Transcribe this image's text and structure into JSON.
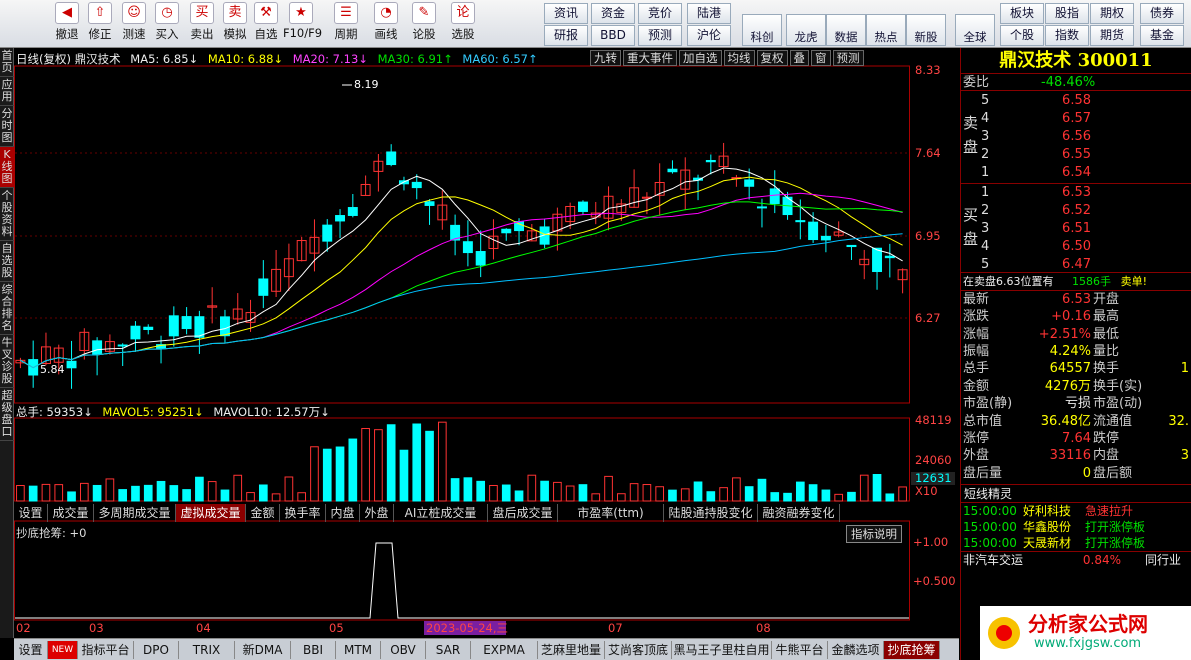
{
  "toolbar": {
    "buttons": [
      "撤退",
      "修正",
      "测速",
      "买入",
      "卖出",
      "模拟",
      "自选",
      "F10/F9",
      "周期",
      "画线",
      "论股",
      "选股"
    ],
    "small_buttons": [
      "资讯",
      "资金",
      "竞价",
      "陆港",
      "研报",
      "BBD",
      "预测",
      "沪伦",
      "科创",
      "龙虎",
      "数据",
      "热点",
      "新股",
      "全球",
      "板块",
      "股指",
      "期权",
      "债券",
      "个股",
      "指数",
      "期货",
      "基金"
    ]
  },
  "leftnav": [
    "首页",
    "应用",
    "分时图",
    "K线图",
    "个股资料",
    "自选股",
    "综合排名",
    "牛叉诊股",
    "超级盘口"
  ],
  "kline_header": {
    "title": "日线(复权)  鼎汉技术",
    "ma5": "MA5: 6.85↓",
    "ma10": "MA10: 6.88↓",
    "ma20": "MA20: 7.13↓",
    "ma30": "MA30: 6.91↑",
    "ma60": "MA60: 6.57↑",
    "tools": [
      "九转",
      "重大事件",
      "加自选",
      "均线",
      "复权",
      "叠",
      "窗",
      "预测"
    ]
  },
  "price_axis": [
    "8.33",
    "7.64",
    "6.95",
    "6.27"
  ],
  "high_label": "8.19",
  "low_label": "5.84",
  "volume_header": {
    "total": "总手: 59353↓",
    "mavol5": "MAVOL5: 95251↓",
    "mavol10": "MAVOL10: 12.57万↓"
  },
  "volume_axis": [
    "48119",
    "24060",
    "12631",
    "X10"
  ],
  "tabs": [
    "设置",
    "成交量",
    "多周期成交量",
    "虚拟成交量",
    "金额",
    "换手率",
    "内盘",
    "外盘",
    "AI立桩成交量",
    "盘后成交量",
    "市盈率(ttm)",
    "陆股通持股变化",
    "融资融券变化"
  ],
  "indicator": {
    "name": "抄底抢筹: +0",
    "help": "指标说明",
    "axis": [
      "+1.00",
      "+0.500"
    ]
  },
  "date_axis": [
    "02",
    "03",
    "04",
    "05",
    "2023-05-24,三",
    "07",
    "08"
  ],
  "bottom_tabs": [
    "设置",
    "NEW",
    "指标平台",
    "DPO",
    "TRIX",
    "新DMA",
    "BBI",
    "MTM",
    "OBV",
    "SAR",
    "EXPMA",
    "芝麻里地量",
    "艾尚客顶底",
    "黑马王子里柱自用",
    "牛熊平台",
    "金麟选项",
    "抄底抢筹"
  ],
  "stock": {
    "name": "鼎汉技术",
    "code": "300011"
  },
  "weibi": {
    "label": "委比",
    "value": "-48.46%"
  },
  "sell": [
    {
      "n": "5",
      "p": "6.58"
    },
    {
      "n": "4",
      "p": "6.57"
    },
    {
      "n": "3",
      "p": "6.56"
    },
    {
      "n": "2",
      "p": "6.55"
    },
    {
      "n": "1",
      "p": "6.54"
    }
  ],
  "buy": [
    {
      "n": "1",
      "p": "6.53"
    },
    {
      "n": "2",
      "p": "6.52"
    },
    {
      "n": "3",
      "p": "6.51"
    },
    {
      "n": "4",
      "p": "6.50"
    },
    {
      "n": "5",
      "p": "6.47"
    }
  ],
  "sell_label": "卖盘",
  "buy_label": "买盘",
  "order_note": {
    "text": "在卖盘6.63位置有",
    "qty": "1586手",
    "tag": "卖单!"
  },
  "quote": [
    {
      "l": "最新",
      "v": "6.53",
      "c": "red",
      "l2": "开盘"
    },
    {
      "l": "涨跌",
      "v": "+0.16",
      "c": "red",
      "l2": "最高"
    },
    {
      "l": "涨幅",
      "v": "+2.51%",
      "c": "red",
      "l2": "最低"
    },
    {
      "l": "振幅",
      "v": "4.24%",
      "c": "yel",
      "l2": "量比"
    },
    {
      "l": "总手",
      "v": "64557",
      "c": "yel",
      "l2": "换手"
    },
    {
      "l": "金额",
      "v": "4276万",
      "c": "yel",
      "l2": "换手(实)"
    },
    {
      "l": "市盈(静)",
      "v": "亏损",
      "c": "white",
      "l2": "市盈(动)"
    },
    {
      "l": "总市值",
      "v": "36.48亿",
      "c": "yel",
      "l2": "流通值"
    },
    {
      "l": "涨停",
      "v": "7.64",
      "c": "red",
      "l2": "跌停"
    },
    {
      "l": "外盘",
      "v": "33116",
      "c": "red",
      "l2": "内盘"
    },
    {
      "l": "盘后量",
      "v": "0",
      "c": "yel",
      "l2": "盘后额"
    }
  ],
  "quote_right": [
    "",
    "",
    "",
    "",
    "1",
    "",
    "",
    "32.",
    "",
    "3",
    ""
  ],
  "duanxian": {
    "title": "短线精灵",
    "items": [
      {
        "t": "15:00:00",
        "s": "好利科技",
        "e": "急速拉升",
        "c": "red"
      },
      {
        "t": "15:00:00",
        "s": "华鑫股份",
        "e": "打开涨停板",
        "c": "green"
      },
      {
        "t": "15:00:00",
        "s": "天晟新材",
        "e": "打开涨停板",
        "c": "green"
      }
    ]
  },
  "sector": {
    "name": "非汽车交运",
    "pct": "0.84%",
    "peer": "同行业"
  },
  "logo": {
    "text": "分析家公式网",
    "url": "www.fxjgsw.com"
  },
  "colors": {
    "up": "#ff3333",
    "down": "#00ffff",
    "ma5": "#ffffff",
    "ma10": "#ffff00",
    "ma20": "#ff00ff",
    "ma30": "#00ff00",
    "ma60": "#00bfff"
  }
}
